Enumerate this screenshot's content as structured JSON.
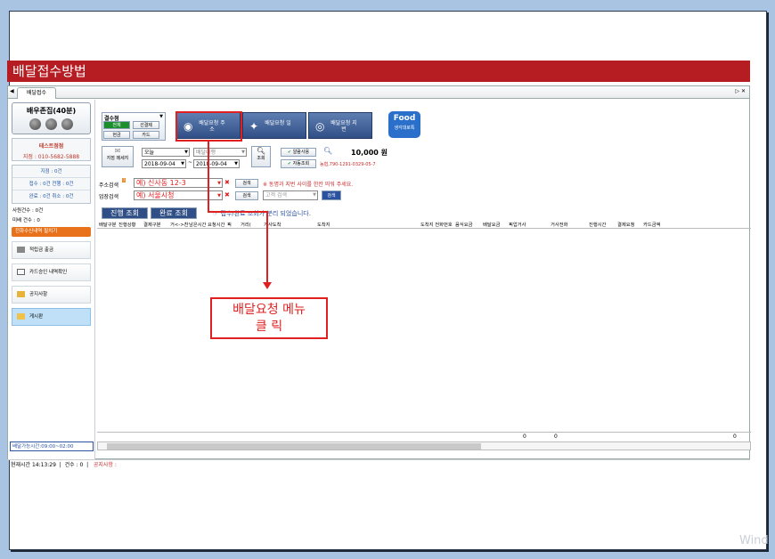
{
  "title": "배달접수방법",
  "tab": {
    "label": "배달접수",
    "left_arrow": "◀",
    "right_controls": "▷ ✕"
  },
  "sidebar": {
    "store_name": "배우존집(40분)",
    "branch_name": "테스트점점",
    "branch_tel": "지점 : 010-5682-5888",
    "stats": [
      "지점 : 0건",
      "접수 : 0건    전행 : 0건",
      "완료 : 0건    취소 : 0건"
    ],
    "line1": "사원건수 : 0건",
    "line2": "미배 건수 : 0",
    "orange_label": "전화수신내역 필치기",
    "menu": [
      "적립금 출금",
      "카드승인 내역확인",
      "공지사항",
      "게시판"
    ],
    "footer": "배달가능시간:09:00~02:00"
  },
  "toolbar": {
    "combo_label": "결수점",
    "pay_buttons": [
      "전체",
      "선결제",
      "현금",
      "카드"
    ],
    "big_buttons": [
      "배달요청 주소",
      "배달요청 일",
      "배달요청 지번"
    ],
    "food_title": "Food",
    "food_sub": "생각대로특",
    "date_preset": "오늘",
    "date_type": "배달대행",
    "message_label": "지점 메세지",
    "date_from": "2018-09-04",
    "date_to": "2018-09-04",
    "search_label": "조회",
    "amount_label": "10,000 원",
    "check_labels": [
      "알람사용",
      "자동조회"
    ],
    "account": "농협,790-1291-0329-05-7"
  },
  "search": {
    "addr_label": "주소검색",
    "addr_value": "예) 신사동 12-3",
    "store_label": "업장검색",
    "store_value": "예) 서울시청",
    "search_btn": "검색",
    "customer_placeholder": "고객 검색",
    "customer_btn": "검색",
    "note": "※ 동명과 지번 사이를 한칸 띄워 주세요.",
    "tab_progress": "진행 조회",
    "tab_done": "완료 조회",
    "split_note": "☞ 접수/완료 조회가 분리 되었습니다."
  },
  "table": {
    "columns": [
      "배달구분",
      "진행상황",
      "결제구분",
      "거<->찬",
      "남은시간",
      "요청시간",
      "픽",
      "거리(",
      "거사도착",
      "도착지",
      "도착지 전화번호",
      "음식요금",
      "배달요금",
      "픽업거사",
      "거사전화",
      "진행시간",
      "결제요청",
      "카드금액"
    ],
    "footer_values": [
      "0",
      "0",
      "0"
    ]
  },
  "status": {
    "time": "현재시간 14:13:29",
    "count": "건수 : 0",
    "notice": "공지사항 :"
  },
  "callout": {
    "line1": "배달요청 메뉴",
    "line2": "클 릭"
  },
  "watermark": "Wind",
  "colors": {
    "title_bg": "#b51d23",
    "annotation": "#e02020",
    "button_blue": "#2f4f86"
  }
}
